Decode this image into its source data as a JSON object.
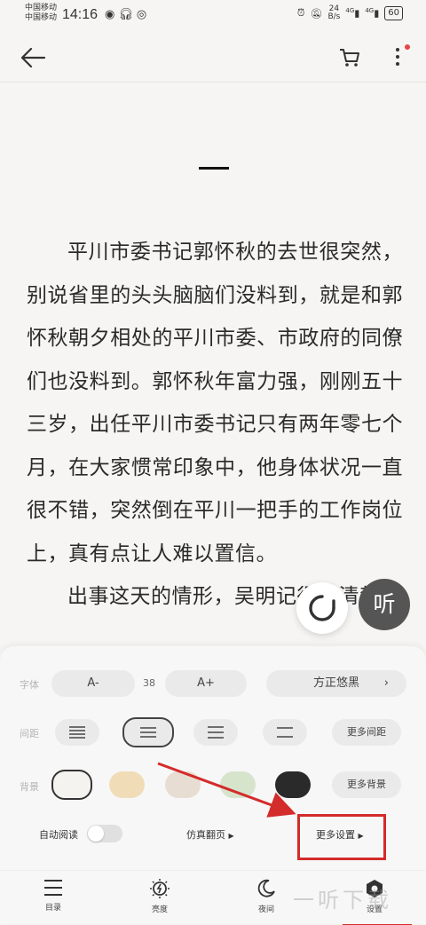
{
  "status_bar": {
    "carrier_1": "中国移动",
    "carrier_2": "中国移动",
    "time": "14:16",
    "netspeed_value": "24",
    "netspeed_unit": "B/s",
    "signal_1": "4G",
    "signal_2": "4G",
    "battery": "60"
  },
  "content": {
    "paragraph_1": "平川市委书记郭怀秋的去世很突然，别说省里的头头脑脑们没料到，就是和郭怀秋朝夕相处的平川市委、市政府的同僚们也没料到。郭怀秋年富力强，刚刚五十三岁，出任平川市委书记只有两年零七个月，在大家惯常印象中，他身体状况一直很不错，突然倒在平川一把手的工作岗位上，真有点让人难以置信。",
    "paragraph_2": "出事这天的情形，吴明记得很清楚。",
    "listen_label": "听"
  },
  "settings": {
    "font_label": "字体",
    "font_decrease": "A-",
    "font_size": "38",
    "font_increase": "A+",
    "font_family": "方正悠黑",
    "spacing_label": "间距",
    "more_spacing": "更多间距",
    "background_label": "背景",
    "more_background": "更多背景",
    "auto_read_label": "自动阅读",
    "page_flip": "仿真翻页",
    "more_settings": "更多设置",
    "backgrounds": [
      "#f4f3ef",
      "#f0ddb8",
      "#e8ddd2",
      "#d7e4cc",
      "#2a2a2a"
    ]
  },
  "bottom_nav": {
    "toc": "目录",
    "brightness": "亮度",
    "night": "夜间",
    "settings": "设置"
  },
  "watermark": "一听下载"
}
